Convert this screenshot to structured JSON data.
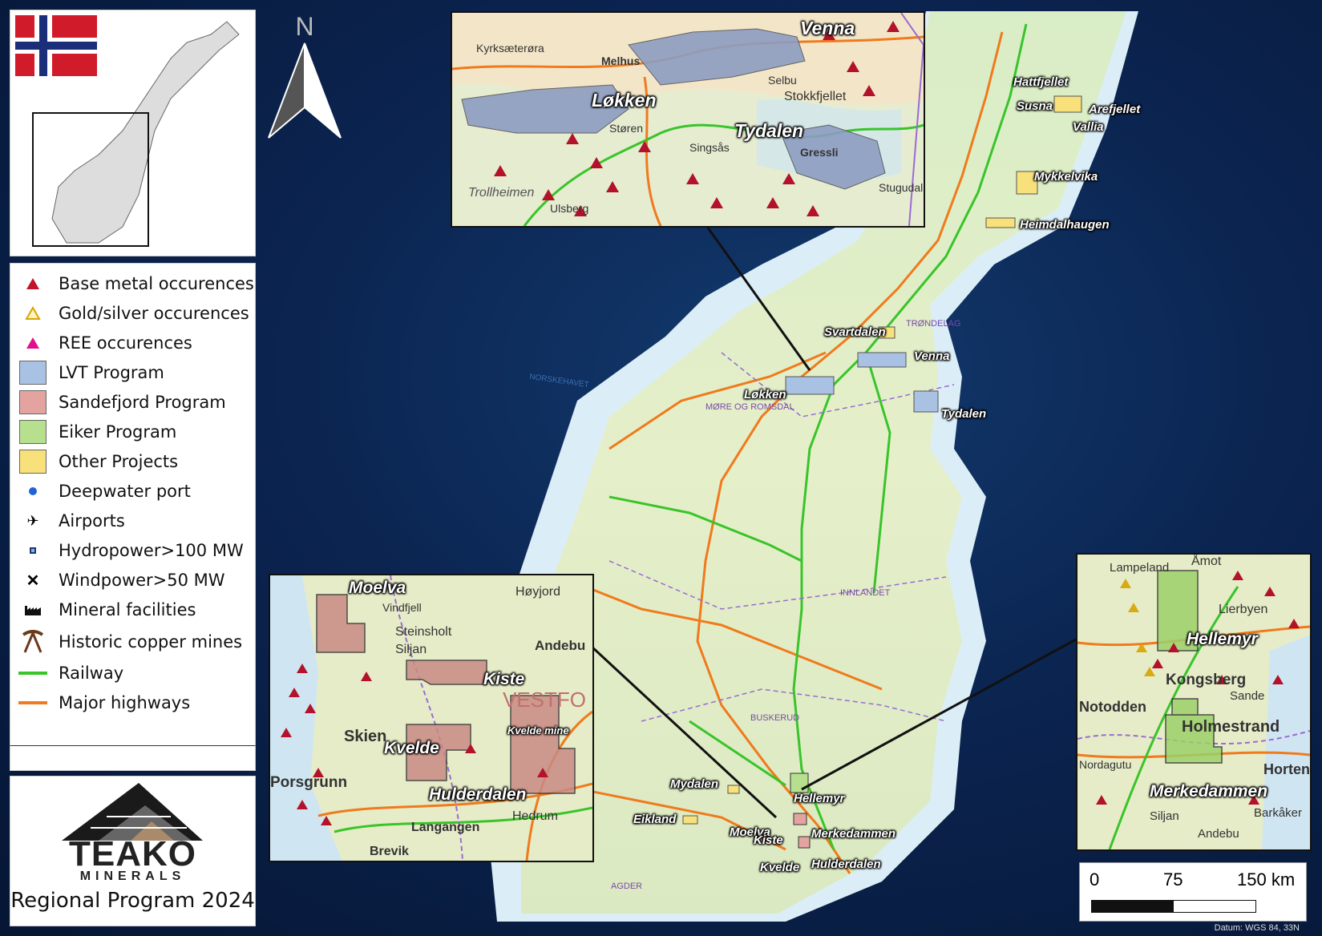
{
  "legend": {
    "items": [
      {
        "label": "Base metal occurences",
        "icon": "red-triangle-icon",
        "color": "#c0142a"
      },
      {
        "label": "Gold/silver occurences",
        "icon": "gold-triangle-icon",
        "color": "#d8a400"
      },
      {
        "label": "REE occurences",
        "icon": "magenta-triangle-icon",
        "color": "#e0108a"
      },
      {
        "label": "LVT Program",
        "icon": "blue-swatch",
        "color": "#a9c1e2"
      },
      {
        "label": "Sandefjord Program",
        "icon": "red-swatch",
        "color": "#e3a4a0"
      },
      {
        "label": "Eiker Program",
        "icon": "green-swatch",
        "color": "#b7e08e"
      },
      {
        "label": "Other Projects",
        "icon": "yellow-swatch",
        "color": "#f8e07a"
      },
      {
        "label": "Deepwater port",
        "icon": "port-icon",
        "color": "#1f63d6"
      },
      {
        "label": "Airports",
        "icon": "airport-icon",
        "color": "#111111"
      },
      {
        "label": "Hydropower>100 MW",
        "icon": "hydro-icon",
        "color": "#1b3a6a"
      },
      {
        "label": "Windpower>50 MW",
        "icon": "wind-icon",
        "color": "#111111"
      },
      {
        "label": "Mineral facilities",
        "icon": "factory-icon",
        "color": "#111111"
      },
      {
        "label": "Historic copper mines",
        "icon": "pickaxe-icon",
        "color": "#6b3a1a"
      },
      {
        "label": "Railway",
        "icon": "railway-line",
        "color": "#39c42a"
      },
      {
        "label": "Major highways",
        "icon": "highway-line",
        "color": "#f07a1c"
      }
    ]
  },
  "logo": {
    "name": "TEAKO",
    "sub": "MINERALS",
    "caption": "Regional Program 2024"
  },
  "north_label": "N",
  "map_labels": {
    "hattfjellet": "Hattfjellet",
    "susna": "Susna",
    "arefjellet": "Arefjellet",
    "vallia": "Vallia",
    "mykkelvika": "Mykkelvika",
    "heimdalhaugen": "Heimdalhaugen",
    "svartdalen": "Svartdalen",
    "venna": "Venna",
    "lokken": "Løkken",
    "tydalen": "Tydalen",
    "mydalen": "Mydalen",
    "hellemyr": "Hellemyr",
    "eikland": "Eikland",
    "moelva": "Moelva",
    "kiste": "Kiste",
    "merkedammen": "Merkedammen",
    "kvelde": "Kvelde",
    "hulderdalen": "Hulderdalen",
    "norskehavet": "NORSKEHAVET",
    "trondelag": "TRØNDELAG",
    "more": "MØRE OG ROMSDAL",
    "innlandet": "INNLANDET",
    "buskerud": "BUSKERUD",
    "agder": "AGDER"
  },
  "inset_top_labels": {
    "venna": "Venna",
    "lokken": "Løkken",
    "tydalen": "Tydalen",
    "melhus": "Melhus",
    "selbu": "Selbu",
    "storen": "Støren",
    "stokkfjellet": "Stokkfjellet",
    "singsas": "Singsås",
    "gressli": "Gressli",
    "kyrksaetero": "Kyrksæterøra",
    "ulsberg": "Ulsberg",
    "stugudal": "Stugudal",
    "trollheimen": "Trollheimen"
  },
  "inset_left_labels": {
    "moelva": "Moelva",
    "kiste": "Kiste",
    "kvelde": "Kvelde",
    "hulderdalen": "Hulderdalen",
    "skien": "Skien",
    "siljan": "Siljan",
    "steinsholt": "Steinsholt",
    "andebu": "Andebu",
    "porsgrunn": "Porsgrunn",
    "hedrum": "Hedrum",
    "langangen": "Langangen",
    "brevik": "Brevik",
    "kvelde_mine": "Kvelde mine",
    "vestfold": "VESTFO",
    "hoyjord": "Høyjord",
    "vindfjell": "Vindfjell"
  },
  "inset_right_labels": {
    "hellemyr": "Hellemyr",
    "merkedammen": "Merkedammen",
    "notodden": "Notodden",
    "kongsberg": "Kongsberg",
    "holmestrand": "Holmestrand",
    "lampeland": "Lampeland",
    "lierbyen": "Lierbyen",
    "siljan": "Siljan",
    "andebu": "Andebu",
    "horten": "Horten",
    "barkaker": "Barkåker",
    "amot": "Åmot",
    "nordagutu": "Nordagutu",
    "sande": "Sande"
  },
  "scale": {
    "t0": "0",
    "t1": "75",
    "t2": "150 km"
  },
  "datum": "Datum: WGS 84, 33N"
}
